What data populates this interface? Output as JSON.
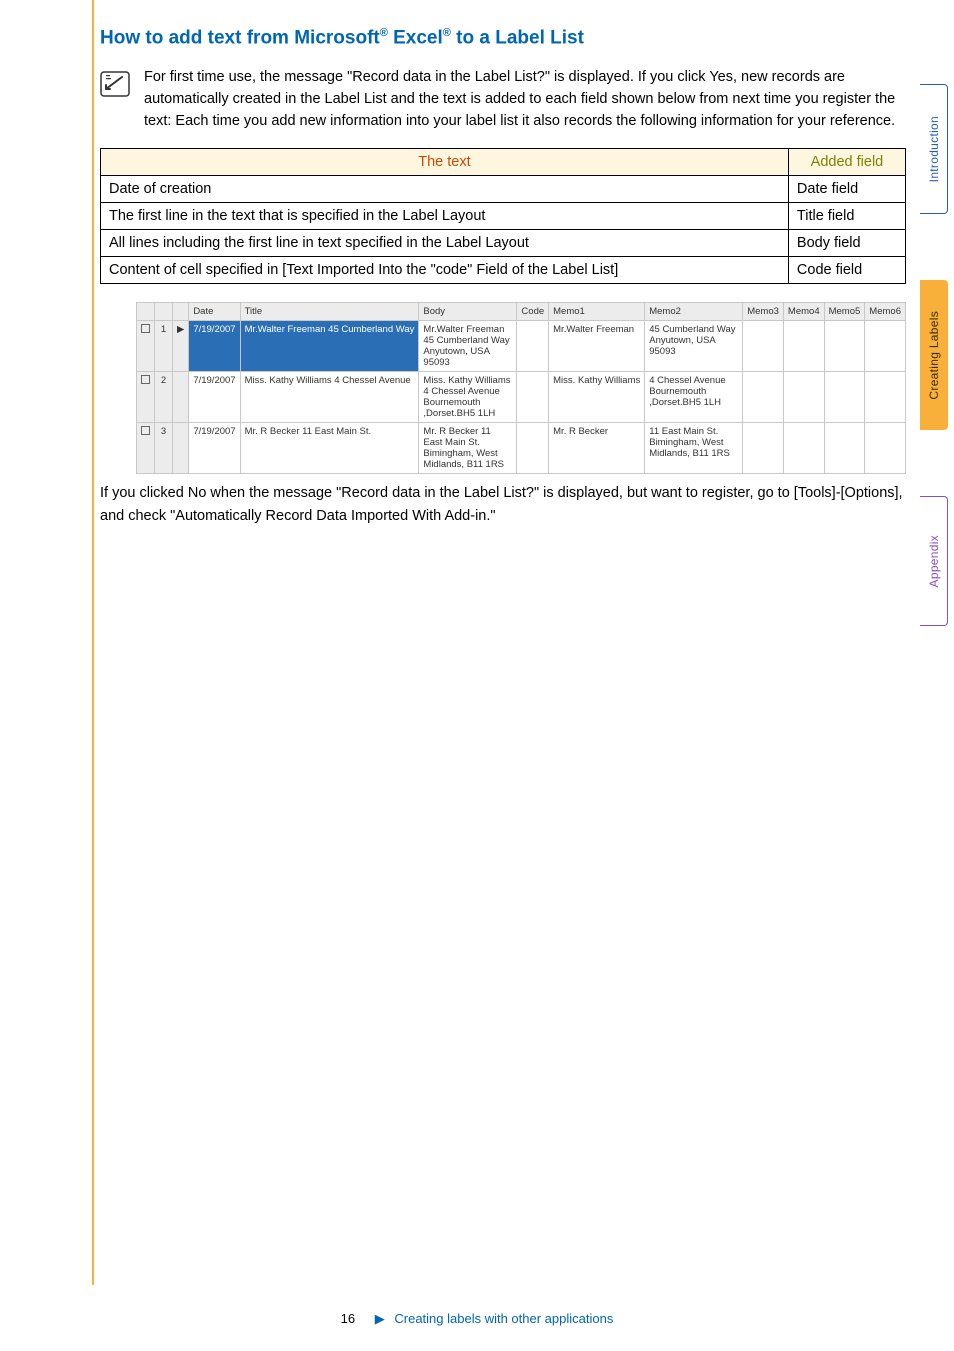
{
  "heading_html": "How to add text from Microsoft<sup>®</sup> Excel<sup>®</sup> to a Label List",
  "note": "For first time use, the message \"Record data in the Label List?\" is displayed. If you click Yes, new records are automatically created in the Label List and the text is added to each field shown below from next time you register the text: Each time you add new information into your label list it also records the following information for your reference.",
  "table": {
    "headers": {
      "text": "The text",
      "added": "Added field"
    },
    "rows": [
      {
        "text": "Date of creation",
        "added": "Date field"
      },
      {
        "text": "The first line in the text that is specified in the Label Layout",
        "added": "Title field"
      },
      {
        "text": "All lines including the first line in text specified in the Label Layout",
        "added": "Body field"
      },
      {
        "text": "Content of cell specified in [Text Imported Into the \"code\" Field of the Label List]",
        "added": "Code field"
      }
    ]
  },
  "grid": {
    "cols": [
      "Date",
      "Title",
      "Body",
      "Code",
      "Memo1",
      "Memo2",
      "Memo3",
      "Memo4",
      "Memo5",
      "Memo6"
    ],
    "rows": [
      {
        "n": "1",
        "date": "7/19/2007",
        "title": "Mr.Walter Freeman 45 Cumberland Way",
        "body": "Mr.Walter Freeman 45 Cumberland Way\nAnyutown, USA  95093",
        "memo1": "Mr.Walter Freeman",
        "memo2": "45 Cumberland Way\nAnyutown, USA  95093",
        "highlight": true
      },
      {
        "n": "2",
        "date": "7/19/2007",
        "title": "Miss. Kathy Williams 4 Chessel Avenue",
        "body": "Miss. Kathy Williams 4 Chessel Avenue\nBournemouth ,Dorset.BH5\n1LH",
        "memo1": "Miss. Kathy Williams",
        "memo2": "4 Chessel Avenue\nBournemouth ,Dorset.BH5\n1LH"
      },
      {
        "n": "3",
        "date": "7/19/2007",
        "title": "Mr. R Becker 11 East Main St.",
        "body": "Mr. R Becker 11 East Main St.\nBimingham, West Midlands,\nB11 1RS",
        "memo1": "Mr. R Becker",
        "memo2": "11 East Main St.\nBimingham, West Midlands,\nB11 1RS"
      }
    ]
  },
  "after_img": "If you clicked No when the message \"Record data in the Label List?\" is displayed, but want to register, go to [Tools]-[Options], and check \"Automatically Record Data Imported With Add-in.\"",
  "footer": {
    "page": "16",
    "link": "Creating labels with other applications"
  },
  "tabs": {
    "intro": "Introduction",
    "create": "Creating Labels",
    "appendix": "Appendix"
  }
}
